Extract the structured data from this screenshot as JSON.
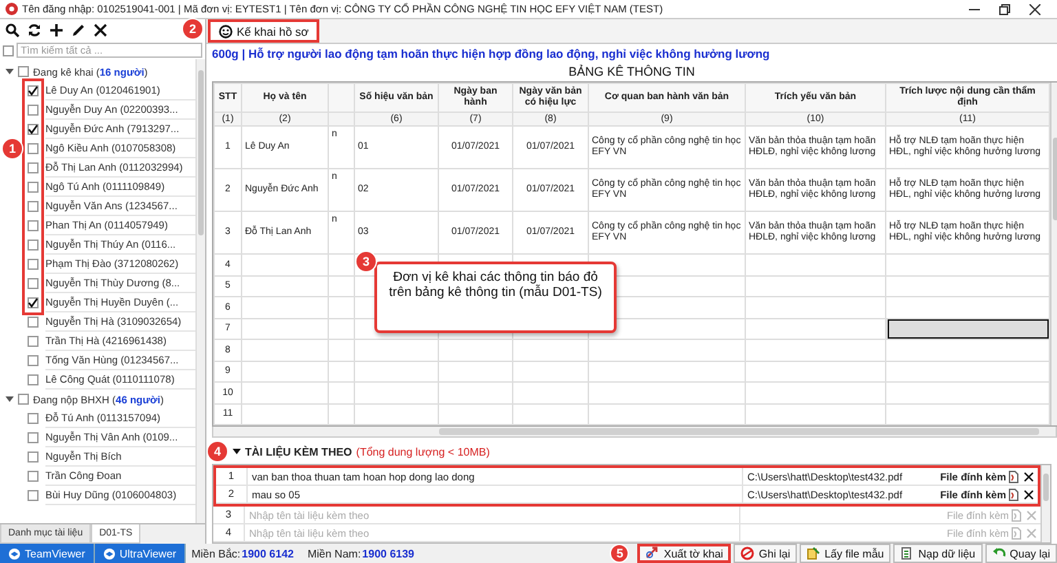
{
  "window": {
    "title": "Tên đăng nhập: 0102519041-001 | Mã đơn vị: EYTEST1 | Tên đơn vị: CÔNG TY CỔ PHẦN CÔNG NGHỆ TIN HỌC EFY VIỆT NAM (TEST)"
  },
  "sidebar": {
    "search": {
      "placeholder": "Tìm kiếm tất cả ...",
      "checked": false
    },
    "groups": [
      {
        "label": "Đang kê khai (**16 người**)",
        "expanded": true,
        "checked": false,
        "items": [
          {
            "label": "Lê Duy An (0120461901)",
            "checked": true
          },
          {
            "label": "Nguyễn Duy An (02200393...",
            "checked": false
          },
          {
            "label": "Nguyễn Đức Anh (7913297...",
            "checked": true
          },
          {
            "label": "Ngô Kiều Anh (0107058308)",
            "checked": false
          },
          {
            "label": "Đỗ Thị Lan Anh (0112032994)",
            "checked": false
          },
          {
            "label": "Ngô Tú Anh (0111109849)",
            "checked": false
          },
          {
            "label": "Nguyễn Văn Ans (1234567...",
            "checked": false
          },
          {
            "label": "Phan Thị An (0114057949)",
            "checked": false
          },
          {
            "label": "Nguyễn Thị Thúy An (0116...",
            "checked": false
          },
          {
            "label": "Phạm Thị Đào (3712080262)",
            "checked": false
          },
          {
            "label": "Nguyễn Thị Thùy Dương (8...",
            "checked": false
          },
          {
            "label": "Nguyễn Thị Huyền Duyên (...",
            "checked": true
          },
          {
            "label": "Nguyễn Thị Hà (3109032654)",
            "checked": false
          },
          {
            "label": "Trần Thị Hà (4216961438)",
            "checked": false
          },
          {
            "label": "Tống Văn Hùng (01234567...",
            "checked": false
          },
          {
            "label": "Lê Công Quát (0110111078)",
            "checked": false
          }
        ]
      },
      {
        "label": "Đang nộp BHXH (**46 người**)",
        "expanded": true,
        "checked": false,
        "items": [
          {
            "label": "Đỗ Tú Anh (0113157094)",
            "checked": false
          },
          {
            "label": "Nguyễn Thị Vân Anh (0109...",
            "checked": false
          },
          {
            "label": "Nguyễn Thị Bích",
            "checked": false
          },
          {
            "label": "Trần Công Đoan",
            "checked": false
          },
          {
            "label": "Bùi Huy Dũng (0106004803)",
            "checked": false
          }
        ]
      }
    ],
    "tabs": [
      {
        "label": "Danh mục tài liệu",
        "selected": false
      },
      {
        "label": "D01-TS",
        "selected": true
      }
    ]
  },
  "main": {
    "tab": {
      "label": "Kế khai hồ sơ",
      "selected": true
    },
    "heading": "600g | Hỗ trợ người lao động tạm hoãn thực hiện hợp đồng lao động, nghỉ việc không hưởng lương",
    "table": {
      "title": "BẢNG KÊ THÔNG TIN",
      "columns": [
        {
          "label": "STT",
          "index": "(1)"
        },
        {
          "label": "Họ và tên",
          "index": "(2)"
        },
        {},
        {
          "label": "Số hiệu văn bản",
          "index": "(6)"
        },
        {
          "label": "Ngày ban hành",
          "index": "(7)"
        },
        {
          "label": "Ngày văn bản có hiệu lực",
          "index": "(8)"
        },
        {
          "label": "Cơ quan ban hành văn bản",
          "index": "(9)"
        },
        {
          "label": "Trích yếu văn bản",
          "index": "(10)"
        },
        {
          "label": "Trích lược nội dung cần thẩm định",
          "index": "(11)"
        }
      ],
      "rows": [
        {
          "cells": [
            "1",
            "Lê Duy An",
            "n",
            "01",
            "01/07/2021",
            "01/07/2021",
            "Công ty cổ phần công nghệ tin học EFY VN",
            "Văn bản thỏa thuận tạm hoãn HĐLĐ, nghỉ việc không lương",
            "Hỗ trợ NLĐ tạm hoãn thực hiện HĐL, nghỉ việc không hưởng lương"
          ],
          "selected": false
        },
        {
          "cells": [
            "2",
            "Nguyễn Đức Anh",
            "n",
            "02",
            "01/07/2021",
            "01/07/2021",
            "Công ty cổ phần công nghệ tin học EFY VN",
            "Văn bản thỏa thuận tạm hoãn HĐLĐ, nghỉ việc không lương",
            "Hỗ trợ NLĐ tạm hoãn thực hiện HĐL, nghỉ việc không hưởng lương"
          ],
          "selected": false
        },
        {
          "cells": [
            "3",
            "Đỗ Thị Lan Anh",
            "n",
            "03",
            "01/07/2021",
            "01/07/2021",
            "Công ty cổ phần công nghệ tin học EFY VN",
            "Văn bản thỏa thuận tạm hoãn HĐLĐ, nghỉ việc không lương",
            "Hỗ trợ NLĐ tạm hoãn thực hiện HĐL, nghỉ việc không hưởng lương"
          ],
          "selected": false
        },
        {
          "cells": [
            "4"
          ],
          "selected": false
        },
        {
          "cells": [
            "5"
          ],
          "selected": false
        },
        {
          "cells": [
            "6"
          ],
          "selected": false
        },
        {
          "cells": [
            "7"
          ],
          "selected": true
        },
        {
          "cells": [
            "8"
          ],
          "selected": false
        },
        {
          "cells": [
            "9"
          ],
          "selected": false
        },
        {
          "cells": [
            "10"
          ],
          "selected": false
        },
        {
          "cells": [
            "11"
          ],
          "selected": false
        }
      ]
    },
    "attachments": {
      "title": "TÀI LIỆU KÈM THEO",
      "note": "(Tổng dung lượng < 10MB)",
      "expanded": true,
      "rows": [
        {
          "index": "1",
          "name": "van ban thoa thuan tam hoan hop dong lao dong",
          "path": "C:\\Users\\hatt\\Desktop\\test432.pdf",
          "file_label": "File đính kèm",
          "attached": true
        },
        {
          "index": "2",
          "name": "mau so 05",
          "path": "C:\\Users\\hatt\\Desktop\\test432.pdf",
          "file_label": "File đính kèm",
          "attached": true
        },
        {
          "index": "3",
          "placeholder": "Nhập tên tài liệu kèm theo",
          "file_label": "File đính kèm",
          "attached": false
        },
        {
          "index": "4",
          "placeholder": "Nhập tên tài liệu kèm theo",
          "file_label": "File đính kèm",
          "attached": false
        }
      ]
    }
  },
  "footer": {
    "apps": [
      {
        "label": "TeamViewer"
      },
      {
        "label": "UltraViewer"
      }
    ],
    "hotlines": [
      {
        "label": "Miền Bắc:",
        "number": "1900 6142"
      },
      {
        "label": "Miền Nam:",
        "number": "1900 6139"
      }
    ],
    "buttons": [
      {
        "label": "Xuất tờ khai",
        "kind": "export"
      },
      {
        "label": "Ghi lại",
        "kind": "save"
      },
      {
        "label": "Lấy file mẫu",
        "kind": "template"
      },
      {
        "label": "Nạp dữ liệu",
        "kind": "import"
      },
      {
        "label": "Quay lại",
        "kind": "back"
      }
    ]
  },
  "annotations": [
    {
      "number": "1"
    },
    {
      "number": "2"
    },
    {
      "number": "3",
      "text": "Đơn vị kê khai các thông tin báo đỏ trên bảng kê thông tin (mẫu D01-TS)"
    },
    {
      "number": "4"
    },
    {
      "number": "5"
    }
  ]
}
